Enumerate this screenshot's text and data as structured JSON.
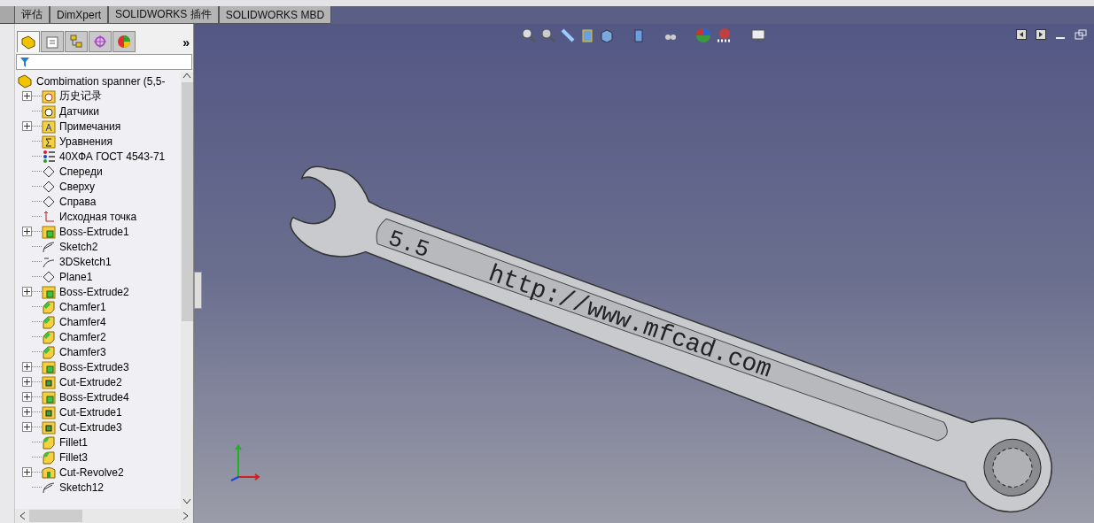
{
  "command_tabs": [
    {
      "label": "评估",
      "selected": false
    },
    {
      "label": "DimXpert",
      "selected": false
    },
    {
      "label": "SOLIDWORKS 插件",
      "selected": false
    },
    {
      "label": "SOLIDWORKS MBD",
      "selected": false
    }
  ],
  "panel_tabs": [
    {
      "kind": "feature",
      "selected": true
    },
    {
      "kind": "property",
      "selected": false
    },
    {
      "kind": "config",
      "selected": false
    },
    {
      "kind": "dimxpert",
      "selected": false
    },
    {
      "kind": "display",
      "selected": false
    }
  ],
  "panel_more": "»",
  "tree": {
    "root": "Combimation spanner  (5,5-",
    "items": [
      {
        "label": "历史记录",
        "kind": "history",
        "expandable": true
      },
      {
        "label": "Датчики",
        "kind": "sensor",
        "expandable": false
      },
      {
        "label": "Примечания",
        "kind": "annotation",
        "expandable": true
      },
      {
        "label": "Уравнения",
        "kind": "equation",
        "expandable": false
      },
      {
        "label": "40ХФА ГОСТ 4543-71",
        "kind": "material",
        "expandable": false
      },
      {
        "label": "Спереди",
        "kind": "plane",
        "expandable": false
      },
      {
        "label": "Сверху",
        "kind": "plane",
        "expandable": false
      },
      {
        "label": "Справа",
        "kind": "plane",
        "expandable": false
      },
      {
        "label": "Исходная точка",
        "kind": "origin",
        "expandable": false
      },
      {
        "label": "Boss-Extrude1",
        "kind": "boss",
        "expandable": true
      },
      {
        "label": "Sketch2",
        "kind": "sketch",
        "expandable": false
      },
      {
        "label": "3DSketch1",
        "kind": "sketch3d",
        "expandable": false
      },
      {
        "label": "Plane1",
        "kind": "plane",
        "expandable": false
      },
      {
        "label": "Boss-Extrude2",
        "kind": "boss",
        "expandable": true
      },
      {
        "label": "Chamfer1",
        "kind": "chamfer",
        "expandable": false
      },
      {
        "label": "Chamfer4",
        "kind": "chamfer",
        "expandable": false
      },
      {
        "label": "Chamfer2",
        "kind": "chamfer",
        "expandable": false
      },
      {
        "label": "Chamfer3",
        "kind": "chamfer",
        "expandable": false
      },
      {
        "label": "Boss-Extrude3",
        "kind": "boss",
        "expandable": true
      },
      {
        "label": "Cut-Extrude2",
        "kind": "cut",
        "expandable": true
      },
      {
        "label": "Boss-Extrude4",
        "kind": "boss",
        "expandable": true
      },
      {
        "label": "Cut-Extrude1",
        "kind": "cut",
        "expandable": true
      },
      {
        "label": "Cut-Extrude3",
        "kind": "cut",
        "expandable": true
      },
      {
        "label": "Fillet1",
        "kind": "fillet",
        "expandable": false
      },
      {
        "label": "Fillet3",
        "kind": "fillet",
        "expandable": false
      },
      {
        "label": "Cut-Revolve2",
        "kind": "revolve",
        "expandable": true
      },
      {
        "label": "Sketch12",
        "kind": "sketch",
        "expandable": false
      }
    ]
  },
  "model": {
    "size_mark": "5.5",
    "engraving": "http://www.mfcad.com"
  }
}
